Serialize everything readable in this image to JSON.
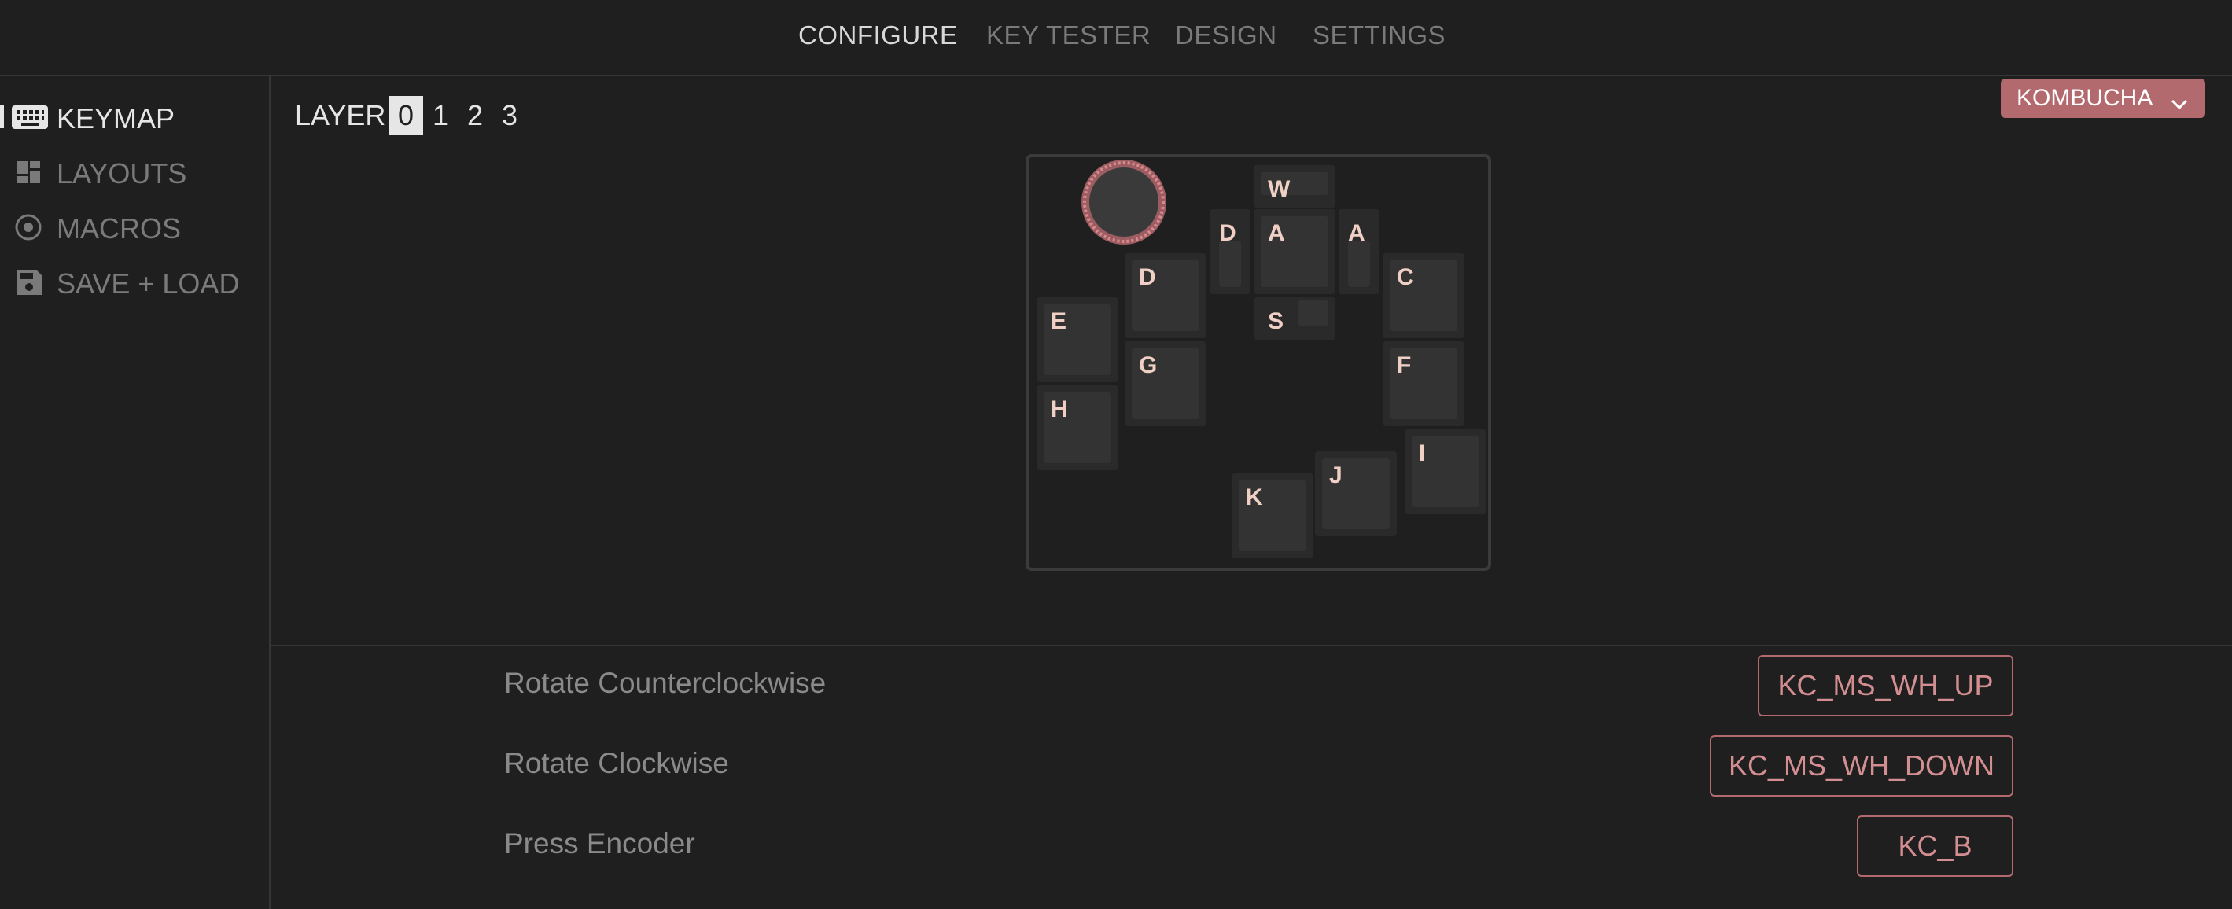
{
  "nav": {
    "tabs": [
      {
        "label": "CONFIGURE"
      },
      {
        "label": "KEY TESTER"
      },
      {
        "label": "DESIGN"
      },
      {
        "label": "SETTINGS"
      }
    ],
    "active": "CONFIGURE"
  },
  "sidebar": {
    "items": [
      {
        "label": "KEYMAP",
        "icon": "keyboard-icon"
      },
      {
        "label": "LAYOUTS",
        "icon": "layouts-icon"
      },
      {
        "label": "MACROS",
        "icon": "macros-icon"
      },
      {
        "label": "SAVE + LOAD",
        "icon": "save-icon"
      }
    ],
    "active": "KEYMAP"
  },
  "layer": {
    "label": "LAYER",
    "options": [
      "0",
      "1",
      "2",
      "3"
    ],
    "selected": "0"
  },
  "keyboard_selector": {
    "value": "KOMBUCHA"
  },
  "keys": [
    {
      "legend": "W"
    },
    {
      "legend": "D"
    },
    {
      "legend": "A"
    },
    {
      "legend": "A"
    },
    {
      "legend": "D"
    },
    {
      "legend": "C"
    },
    {
      "legend": "E"
    },
    {
      "legend": "S"
    },
    {
      "legend": "G"
    },
    {
      "legend": "F"
    },
    {
      "legend": "H"
    },
    {
      "legend": "I"
    },
    {
      "legend": "J"
    },
    {
      "legend": "K"
    }
  ],
  "encoder_actions": [
    {
      "label": "Rotate Counterclockwise",
      "keycode": "KC_MS_WH_UP"
    },
    {
      "label": "Rotate Clockwise",
      "keycode": "KC_MS_WH_DOWN"
    },
    {
      "label": "Press Encoder",
      "keycode": "KC_B"
    }
  ],
  "colors": {
    "accent": "#b36a6e",
    "background": "#1f1f1f",
    "legend": "#f0d0c4"
  }
}
